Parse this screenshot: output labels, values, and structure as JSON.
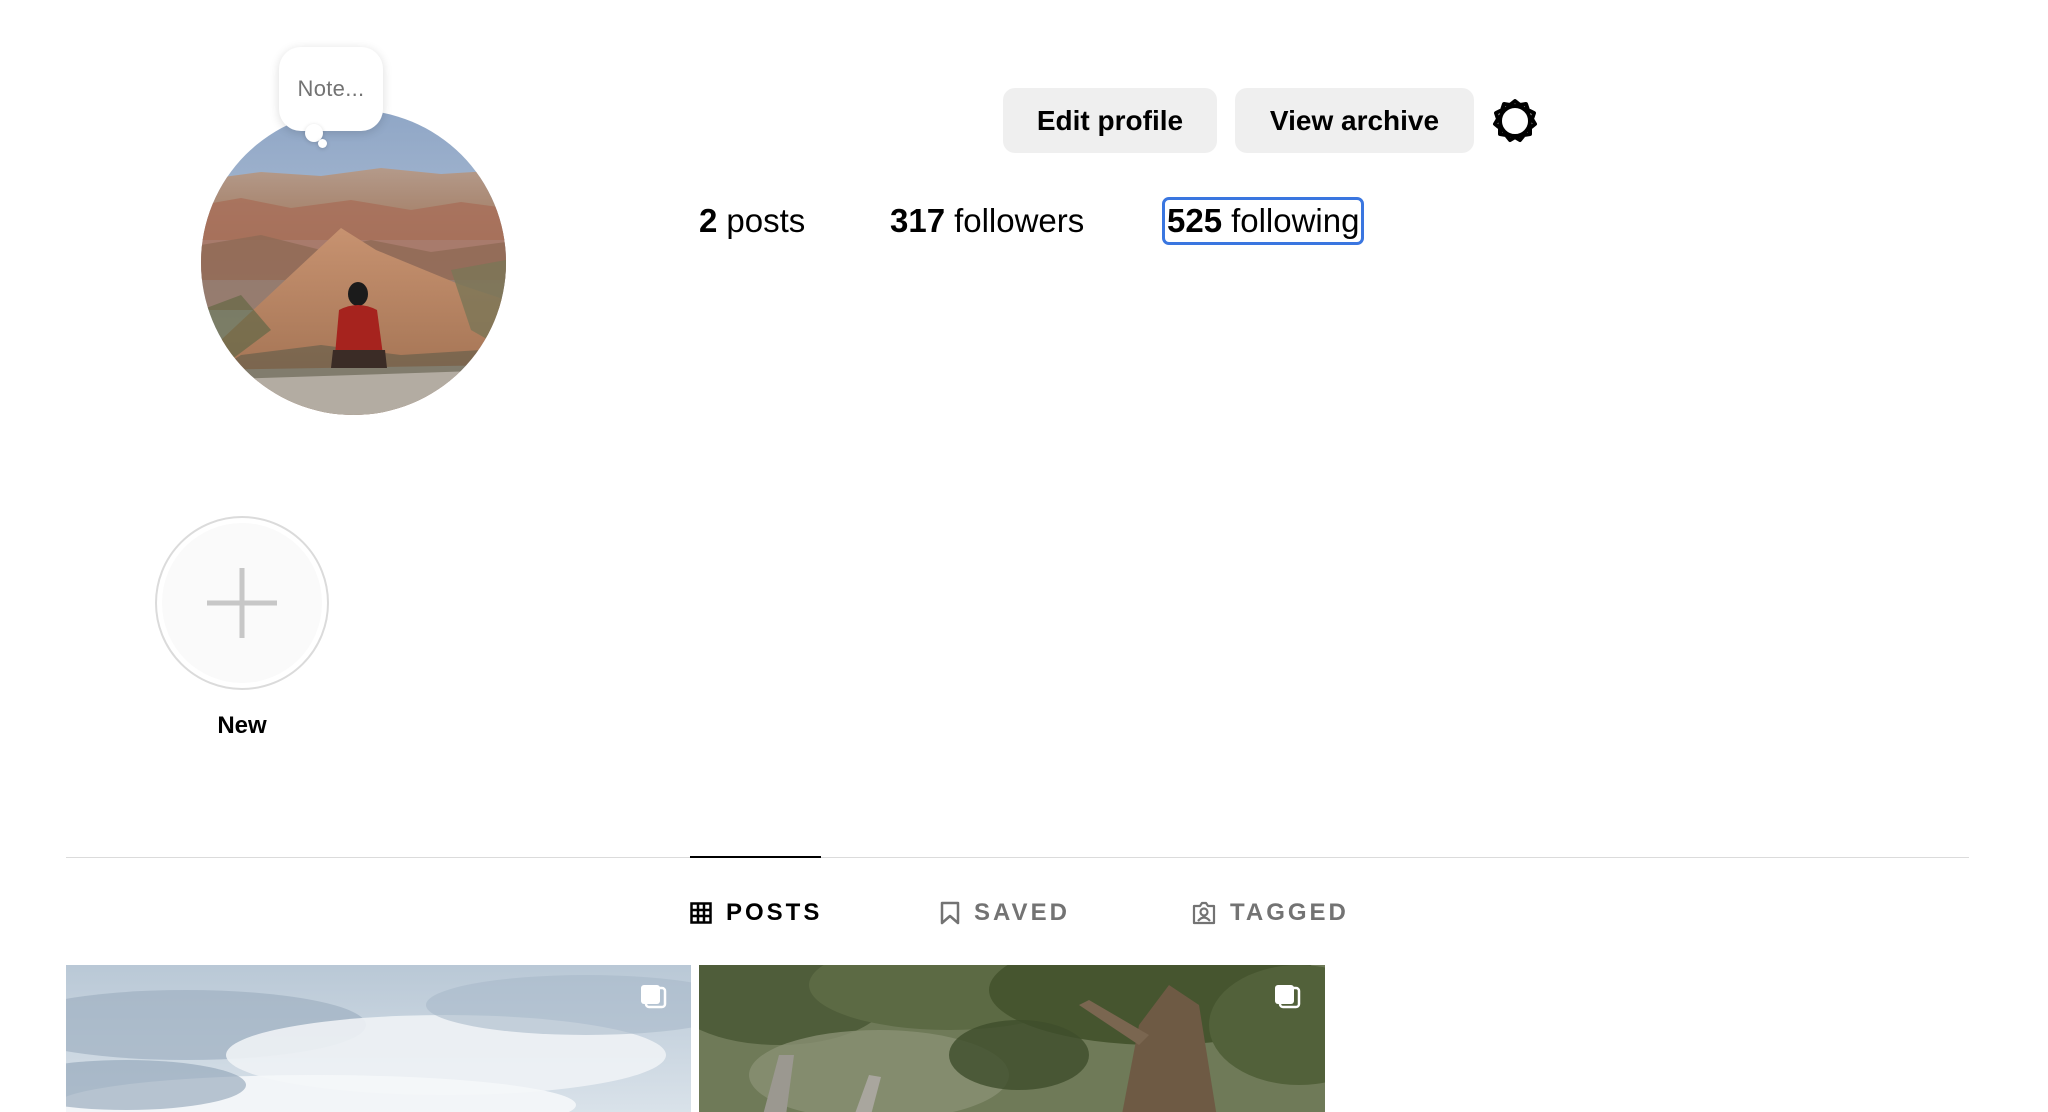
{
  "profile": {
    "note_placeholder": "Note...",
    "avatar_alt": "profile picture"
  },
  "actions": {
    "edit_profile_label": "Edit profile",
    "view_archive_label": "View archive",
    "settings_icon": "gear-icon"
  },
  "stats": {
    "posts_count": "2",
    "posts_label": "posts",
    "followers_count": "317",
    "followers_label": "followers",
    "following_count": "525",
    "following_label": "following"
  },
  "highlights": {
    "new_label": "New",
    "new_icon": "plus-icon"
  },
  "tabs": [
    {
      "label": "POSTS",
      "icon": "grid-icon",
      "active": true
    },
    {
      "label": "SAVED",
      "icon": "bookmark-icon",
      "active": false
    },
    {
      "label": "TAGGED",
      "icon": "tagged-user-icon",
      "active": false
    }
  ],
  "posts": [
    {
      "type": "carousel",
      "icon": "carousel-icon"
    },
    {
      "type": "carousel",
      "icon": "carousel-icon"
    }
  ],
  "colors": {
    "button_bg": "#efefef",
    "focus_ring": "#3a76e0",
    "muted_text": "#737373",
    "divider": "#dbdbdb"
  }
}
